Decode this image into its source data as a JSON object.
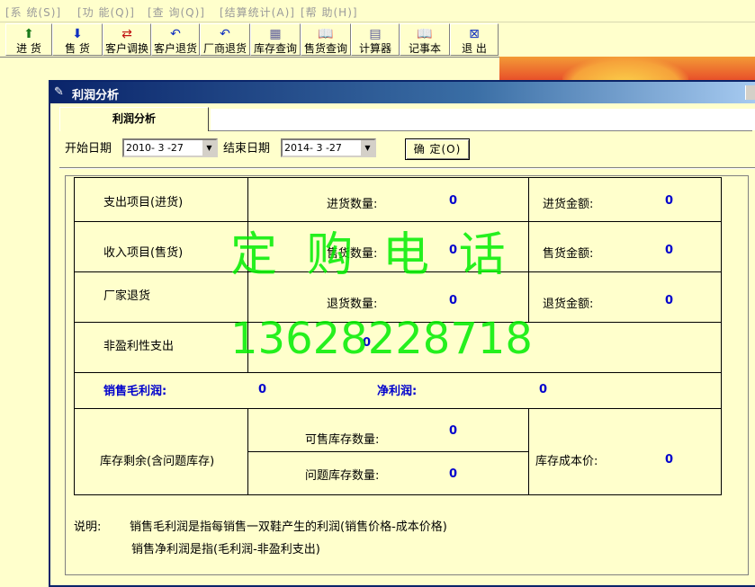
{
  "menu": [
    {
      "label": "[系  统(S)]"
    },
    {
      "label": "[功  能(Q)]"
    },
    {
      "label": "[查  询(Q)]"
    },
    {
      "label": "[结算统计(A)]"
    },
    {
      "label": "[帮  助(H)]"
    }
  ],
  "toolbar": [
    {
      "label": "进 货",
      "icon": "up-arrow-icon"
    },
    {
      "label": "售 货",
      "icon": "down-arrow-icon"
    },
    {
      "label": "客户调换",
      "icon": "swap-icon"
    },
    {
      "label": "客户退货",
      "icon": "undo-icon"
    },
    {
      "label": "厂商退货",
      "icon": "undo-icon"
    },
    {
      "label": "库存查询",
      "icon": "stock-icon"
    },
    {
      "label": "售货查询",
      "icon": "book-icon"
    },
    {
      "label": "计算器",
      "icon": "calculator-icon"
    },
    {
      "label": "记事本",
      "icon": "book-icon"
    },
    {
      "label": "退 出",
      "icon": "exit-icon"
    }
  ],
  "window": {
    "title": "利润分析",
    "tab": "利润分析",
    "start_label": "开始日期",
    "start_value": "2010- 3 -27",
    "end_label": "结束日期",
    "end_value": "2014- 3 -27",
    "ok_button": "确 定(O)"
  },
  "grid": {
    "expense_label": "支出项目(进货)",
    "purchase_qty_label": "进货数量:",
    "purchase_qty": "0",
    "purchase_amt_label": "进货金额:",
    "purchase_amt": "0",
    "income_label": "收入项目(售货)",
    "sales_qty_label": "售货数量:",
    "sales_qty": "0",
    "sales_amt_label": "售货金额:",
    "sales_amt": "0",
    "vendor_return_label": "厂家退货",
    "return_qty_label": "退货数量:",
    "return_qty": "0",
    "return_amt_label": "退货金额:",
    "return_amt": "0",
    "nonprofit_label": "非盈利性支出",
    "nonprofit_value": "0",
    "gross_profit_label": "销售毛利润:",
    "gross_profit_value": "0",
    "net_profit_label": "净利润:",
    "net_profit_value": "0",
    "inventory_label": "库存剩余(含问题库存)",
    "sellable_qty_label": "可售库存数量:",
    "sellable_qty": "0",
    "problem_qty_label": "问题库存数量:",
    "problem_qty": "0",
    "cost_label": "库存成本价:",
    "cost_value": "0"
  },
  "notes": {
    "prefix": "说明:",
    "line1": "销售毛利润是指每销售一双鞋产生的利润(销售价格-成本价格)",
    "line2": "销售净利润是指(毛利润-非盈利支出)"
  },
  "watermark": {
    "line1": "定 购 电 话",
    "line2": "13628228718"
  },
  "colors": {
    "background": "#ffffcc",
    "title_bar": "#0a246a",
    "value_blue": "#0000cc",
    "watermark": "#00ee00"
  }
}
